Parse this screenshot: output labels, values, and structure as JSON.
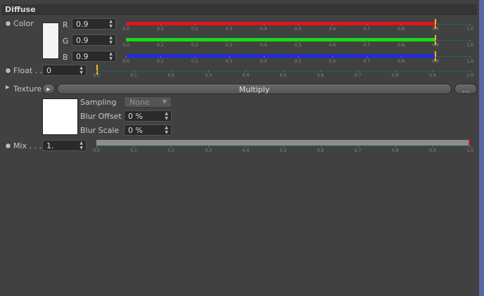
{
  "section": {
    "title": "Diffuse"
  },
  "color": {
    "label": "Color",
    "channels": [
      {
        "label": "R",
        "value": "0.9",
        "fill": "#e3141a",
        "level": 0.9
      },
      {
        "label": "G",
        "value": "0.9",
        "fill": "#19d619",
        "level": 0.9
      },
      {
        "label": "B",
        "value": "0.9",
        "fill": "#1d2de0",
        "level": 0.9
      }
    ]
  },
  "float": {
    "label": "Float . .",
    "value": "0",
    "level": 0
  },
  "ticks": [
    "0.0",
    "0.1",
    "0.2",
    "0.3",
    "0.4",
    "0.5",
    "0.6",
    "0.7",
    "0.8",
    "0.9",
    "1.0"
  ],
  "texture": {
    "label": "Texture",
    "button_label": "Multiply",
    "more_label": "...",
    "sampling_label": "Sampling",
    "sampling_value": "None",
    "blur_offset_label": "Blur Offset",
    "blur_offset_value": "0 %",
    "blur_scale_label": "Blur Scale",
    "blur_scale_value": "0 %"
  },
  "mix": {
    "label": "Mix . . .",
    "value": "1.",
    "level": 1.0
  },
  "colors": {
    "handle": "#f5b820",
    "mix_end": "#d91e1e"
  }
}
